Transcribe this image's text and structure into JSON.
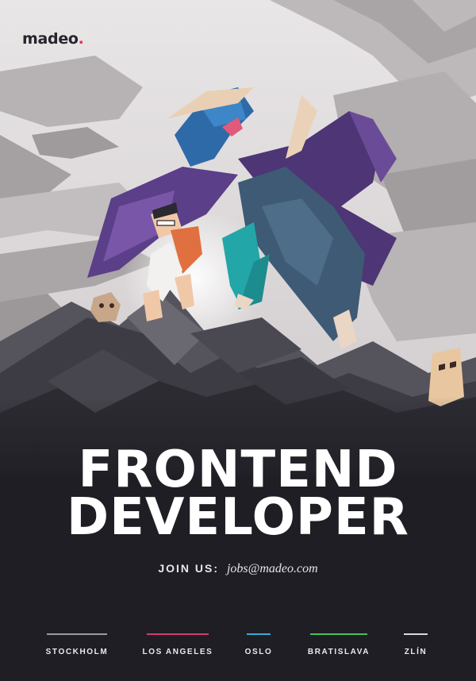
{
  "brand": {
    "logo_text": "madeo",
    "logo_dot": ".",
    "accent": "#e8334a"
  },
  "headline": {
    "line1": "FRONTEND",
    "line2": "DEVELOPER"
  },
  "join": {
    "label": "JOIN US:",
    "email": "jobs@madeo.com"
  },
  "cities": [
    {
      "name": "STOCKHOLM",
      "color": "#9a9aa6"
    },
    {
      "name": "LOS ANGELES",
      "color": "#d23c6a"
    },
    {
      "name": "OSLO",
      "color": "#3aa9d8"
    },
    {
      "name": "BRATISLAVA",
      "color": "#45c25a"
    },
    {
      "name": "ZLÍN",
      "color": "#d9d9e0"
    }
  ],
  "colors": {
    "sky": "#e4e1e2",
    "mountain": "#2a2930",
    "dragon": "#5a3f86",
    "dragon_belly": "#23a6a8",
    "background": "#1f1e24"
  }
}
